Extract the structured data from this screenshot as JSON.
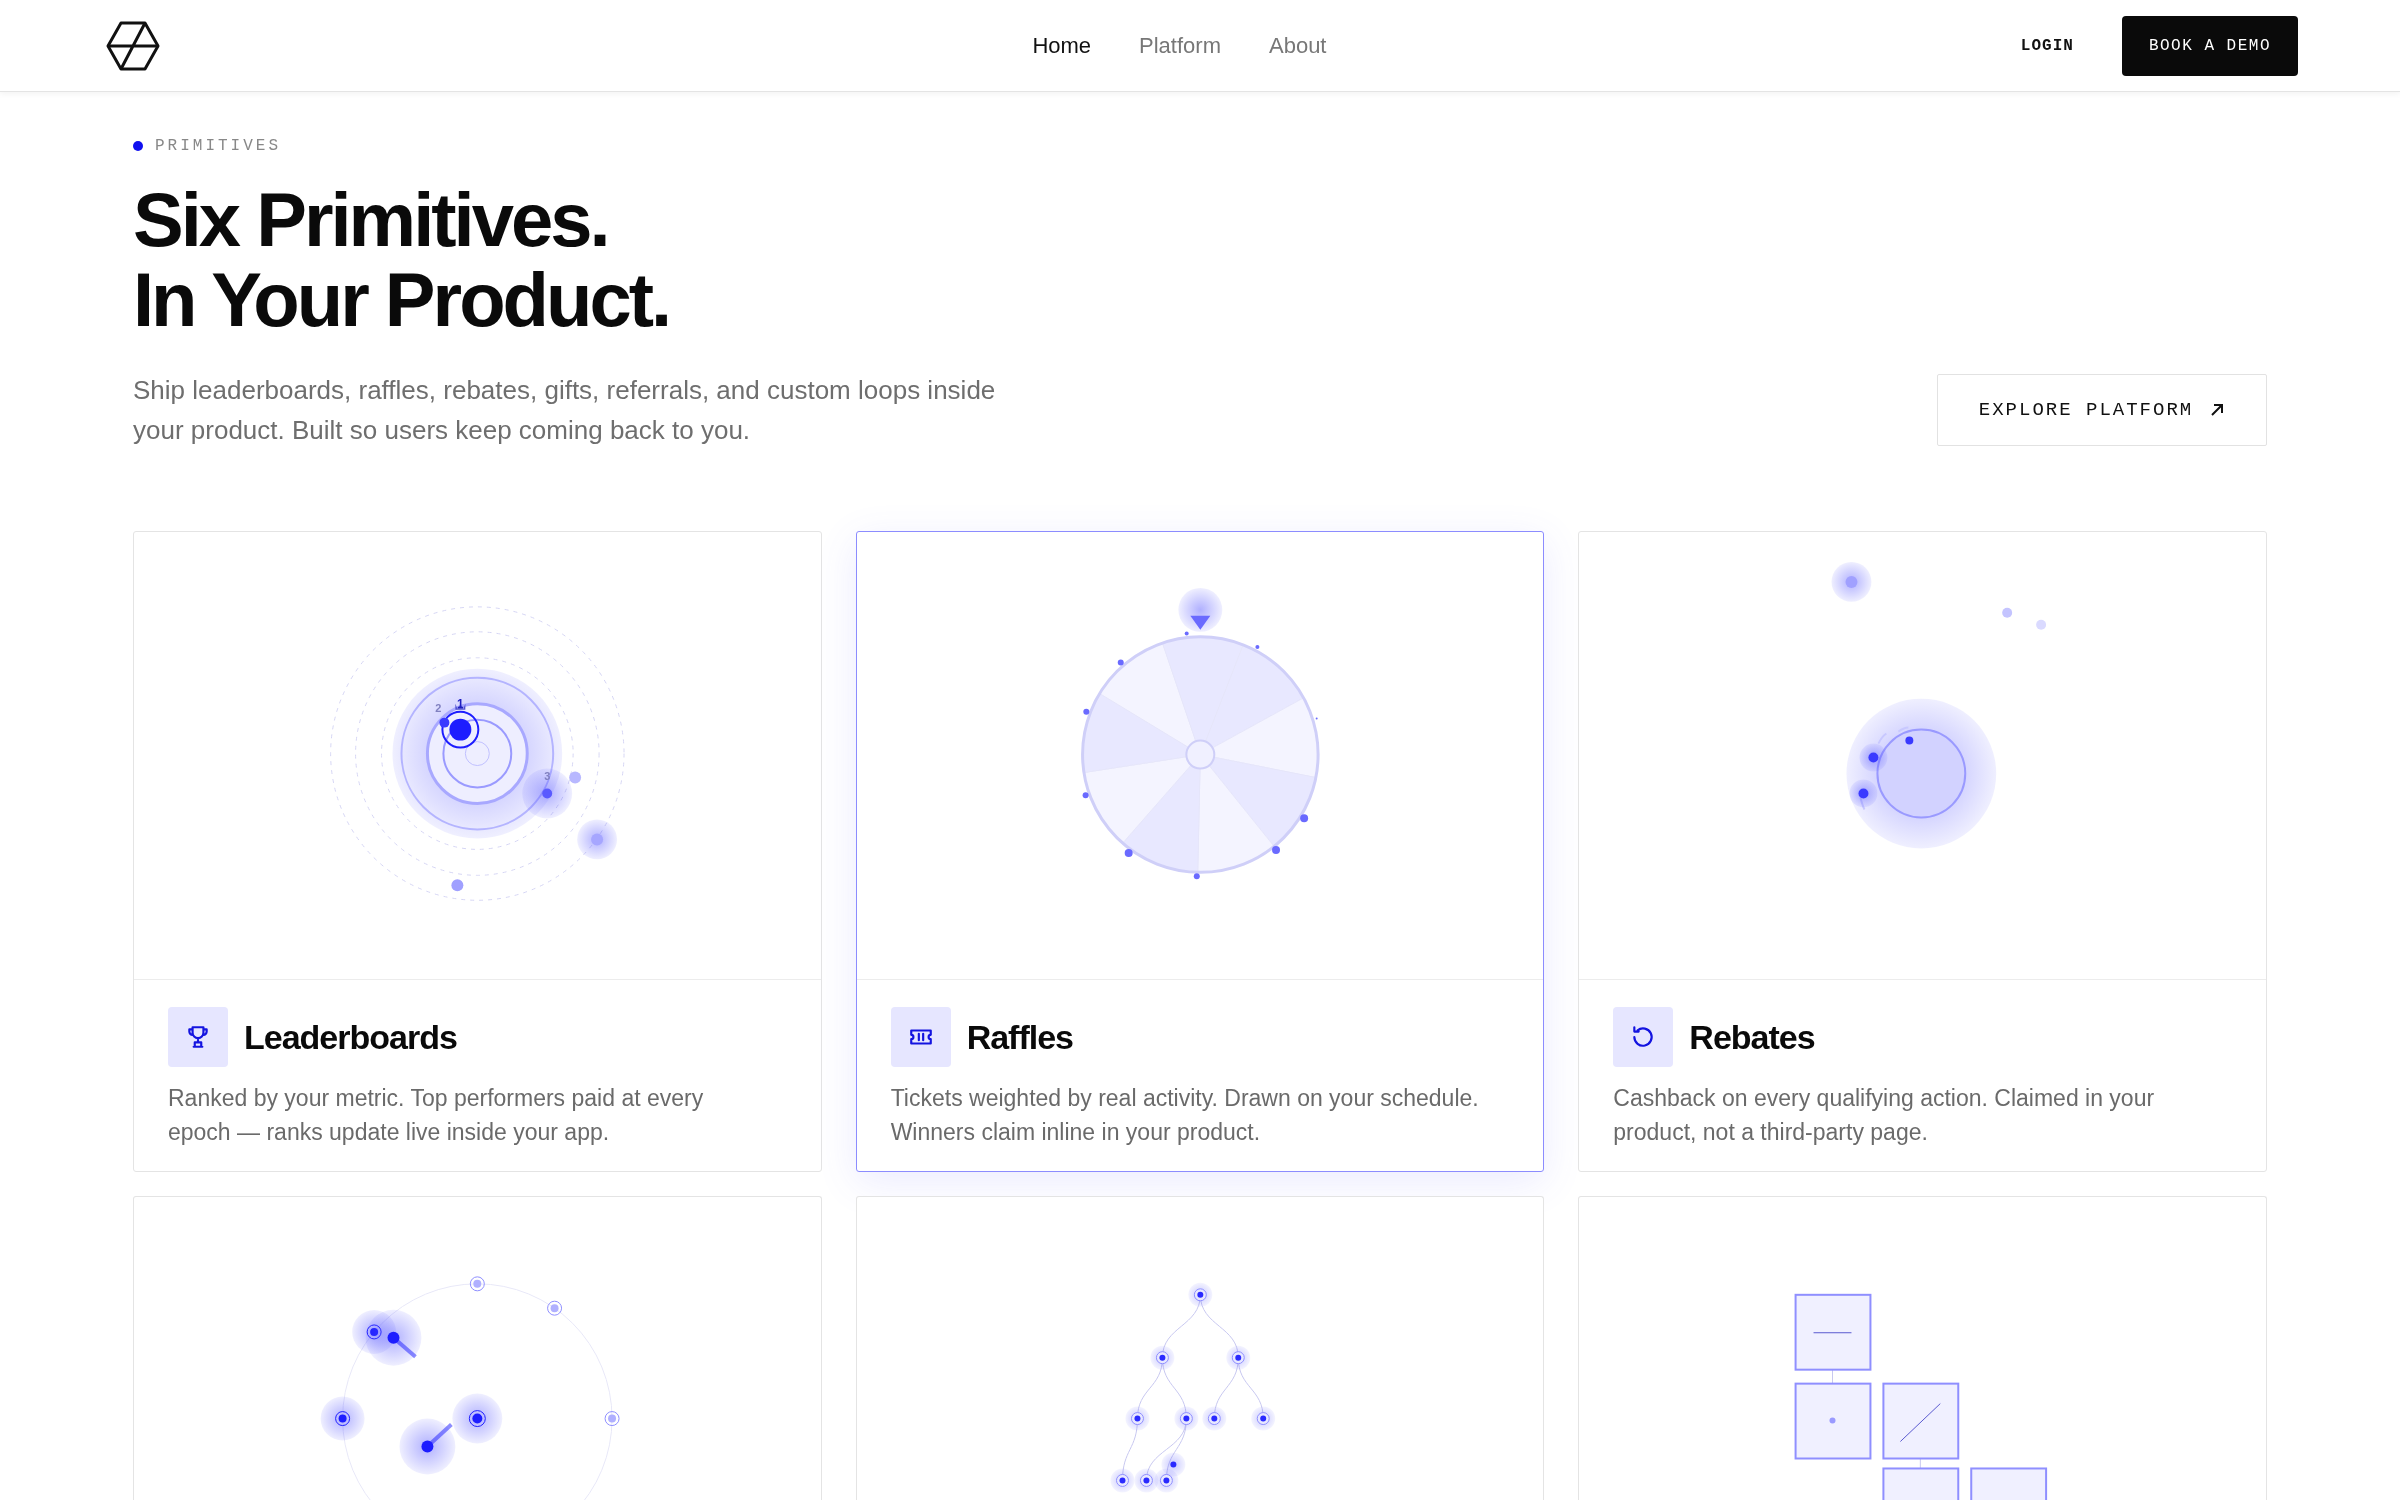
{
  "nav": {
    "links": [
      {
        "label": "Home",
        "selected": true
      },
      {
        "label": "Platform",
        "selected": false
      },
      {
        "label": "About",
        "selected": false
      }
    ],
    "login": "LOGIN",
    "cta": "BOOK A DEMO"
  },
  "hero": {
    "eyebrow": "PRIMITIVES",
    "headline": [
      "Six Primitives.",
      "In Your Product."
    ],
    "lead": "Ship leaderboards, raffles, rebates, gifts, referrals, and custom loops inside your product. Built so users keep coming back to you.",
    "button": "EXPLORE PLATFORM"
  },
  "cards": [
    {
      "kind": "orbit",
      "title": "Leaderboards",
      "description": "Ranked by your metric. Top performers paid at every epoch — ranks update live inside your app.",
      "labels": [
        "2",
        "1",
        "3"
      ],
      "selected": false
    },
    {
      "kind": "wheel",
      "title": "Raffles",
      "description": "Tickets weighted by real activity. Drawn on your schedule. Winners claim inline in your product.",
      "selected": true
    },
    {
      "kind": "coin",
      "title": "Rebates",
      "description": "Cashback on every qualifying action. Claimed in your product, not a third-party page.",
      "selected": false
    },
    {
      "kind": "burst",
      "selected": false
    },
    {
      "kind": "tree",
      "selected": false
    },
    {
      "kind": "blocks",
      "selected": false
    }
  ]
}
